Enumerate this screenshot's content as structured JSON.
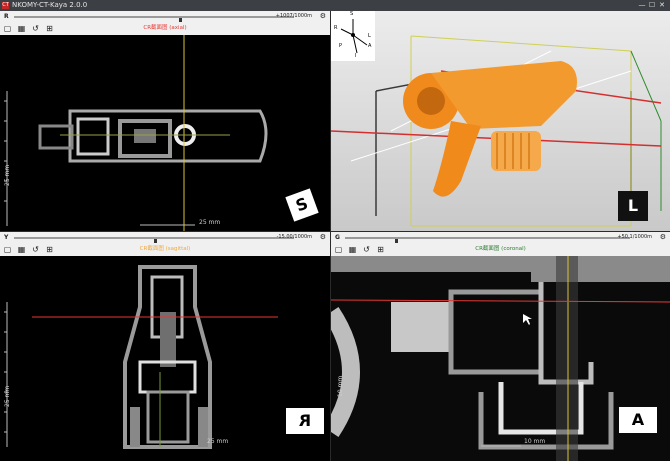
{
  "window": {
    "app_icon": "CT",
    "title": "NKOMY-CT-Kaya 2.0.0",
    "buttons": [
      "—",
      "☐",
      "✕"
    ]
  },
  "panes": {
    "top_left": {
      "axis": "R",
      "readout": "+1007/1000m",
      "view_name": "CR截面图 (axial)",
      "view_color": "#e53935",
      "scale": "25 mm",
      "side_scale": "25 mm",
      "orientation": "S"
    },
    "top_right": {
      "gizmo_labels": [
        "S",
        "R",
        "L",
        "A",
        "I",
        "P"
      ],
      "orientation": "L"
    },
    "bottom_left": {
      "axis": "Y",
      "readout": "-15.00/1000m",
      "view_name": "CR截面图 (sagittal)",
      "view_color": "#f2a83a",
      "scale": "25 mm",
      "side_scale": "25 mm",
      "orientation": "R"
    },
    "bottom_right": {
      "axis": "G",
      "readout": "+50.1/1000m",
      "view_name": "CR截面图 (coronal)",
      "view_color": "#2e7d32",
      "scale": "10 mm",
      "side_scale": "10 mm",
      "orientation": "A"
    }
  },
  "toolbar_icons": [
    "square-icon",
    "grid-icon",
    "reset-icon",
    "layout-icon"
  ],
  "accent": {
    "red_line": "#e53935",
    "yellow_line": "#d8c23a",
    "orange_model": "#f08a1c"
  }
}
